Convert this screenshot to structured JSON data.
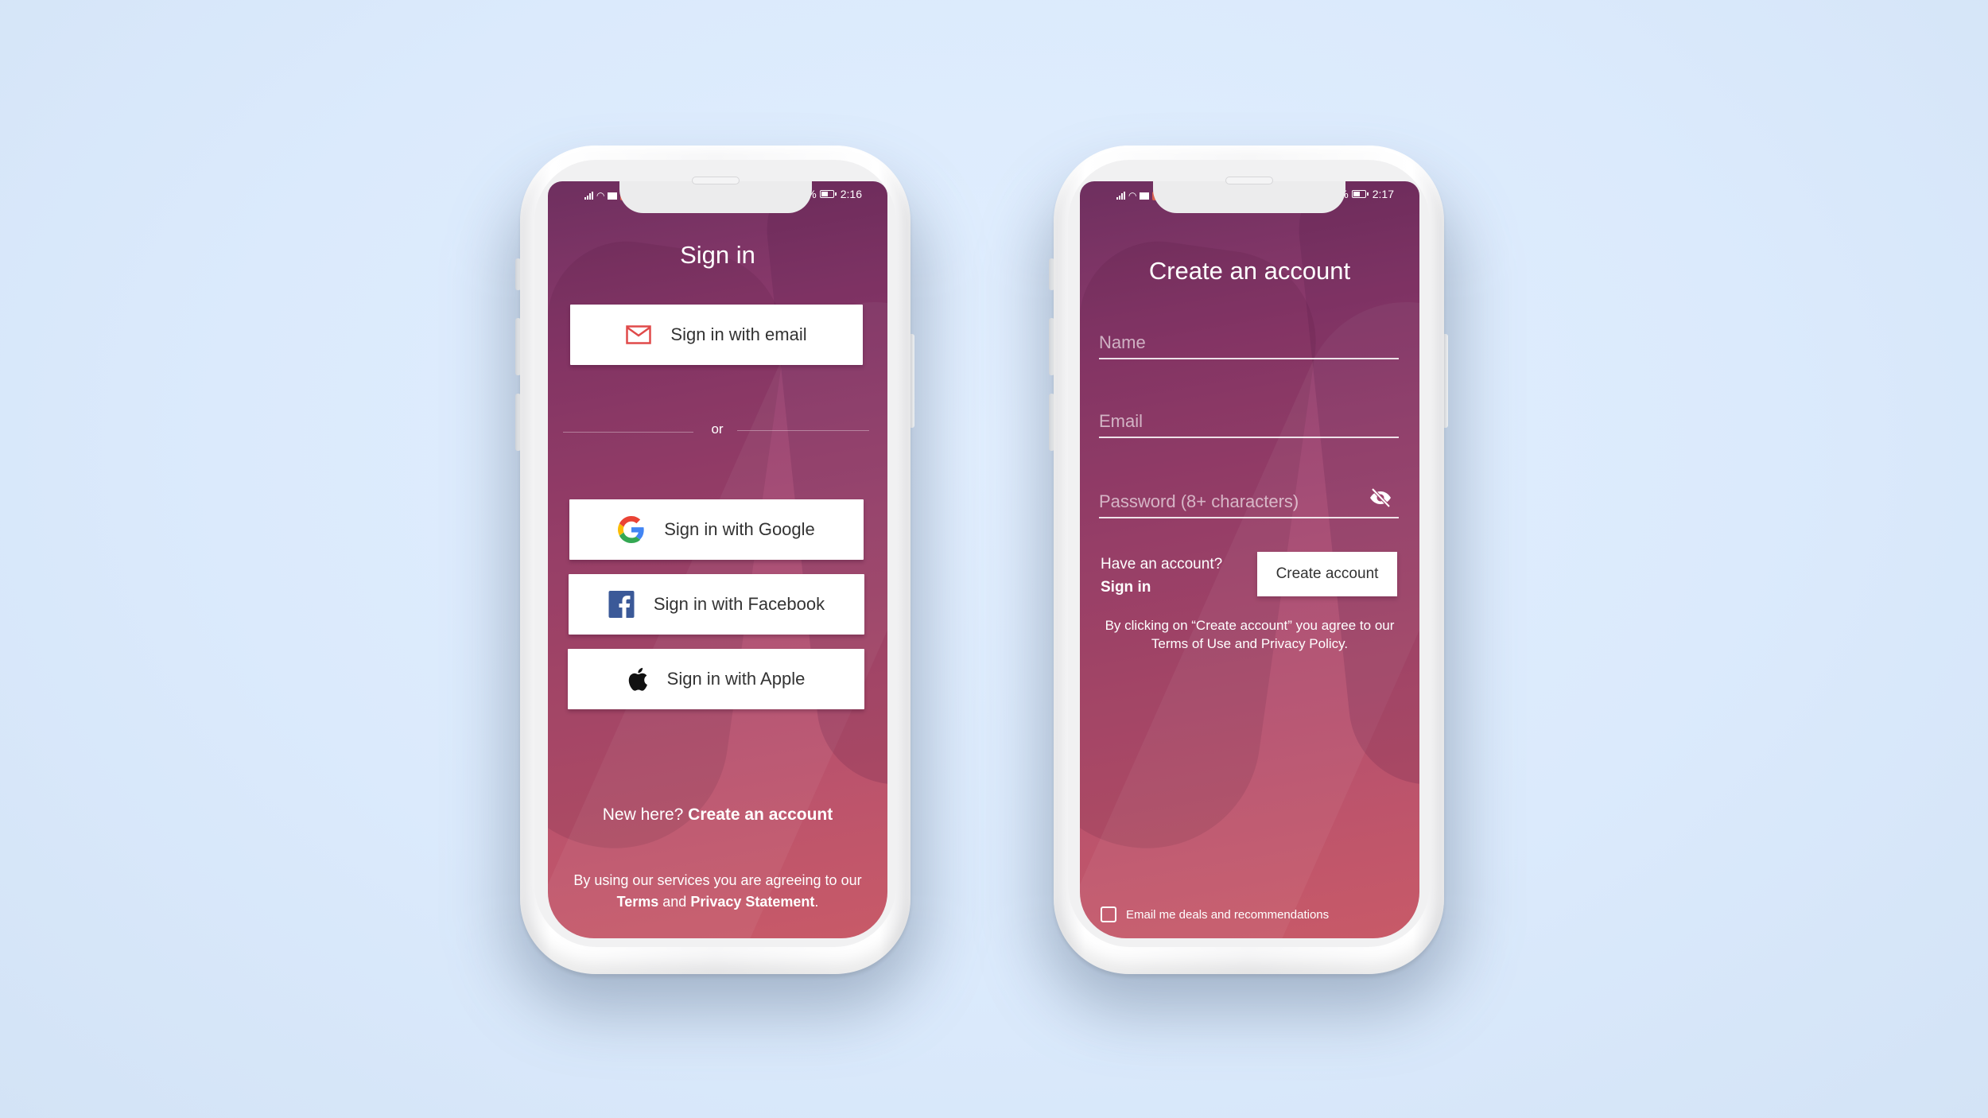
{
  "colors": {
    "background": "#dbeafc",
    "gradient_top": "#6e2f5f",
    "gradient_bottom": "#c85a68",
    "email_icon": "#e04a4a",
    "facebook": "#3b5998",
    "google_blue": "#4285F4",
    "google_red": "#EA4335",
    "google_yellow": "#FBBC05",
    "google_green": "#34A853"
  },
  "phones": [
    {
      "screen": "sign-in",
      "status_bar": {
        "battery_pct_visible": "%",
        "time": "2:16",
        "icons_left": [
          "signal-icon",
          "wifi-icon",
          "mail-icon",
          "notification-icon"
        ]
      },
      "title": "Sign in",
      "email_button": {
        "label": "Sign in with email",
        "icon": "envelope-icon"
      },
      "divider": {
        "label": "or"
      },
      "social_buttons": [
        {
          "label": "Sign in with Google",
          "icon": "google-icon"
        },
        {
          "label": "Sign in with Facebook",
          "icon": "facebook-icon"
        },
        {
          "label": "Sign in with Apple",
          "icon": "apple-icon"
        }
      ],
      "footer": {
        "prompt": "New here?",
        "link": "Create an account"
      },
      "legal": {
        "prefix": "By using our services you are agreeing to our",
        "terms": "Terms",
        "and": "and",
        "privacy": "Privacy Statement",
        "suffix": "."
      }
    },
    {
      "screen": "create-account",
      "status_bar": {
        "battery_pct_visible": "%",
        "time": "2:17",
        "icons_left": [
          "signal-icon",
          "wifi-icon",
          "mail-icon",
          "notification-icon"
        ]
      },
      "title": "Create an account",
      "fields": [
        {
          "name": "name",
          "placeholder": "Name",
          "value": ""
        },
        {
          "name": "email",
          "placeholder": "Email",
          "value": ""
        },
        {
          "name": "password",
          "placeholder": "Password (8+ characters)",
          "value": "",
          "toggle_icon": "eye-off-icon"
        }
      ],
      "have_account": {
        "prompt": "Have an account?",
        "link": "Sign in"
      },
      "create_button": {
        "label": "Create account"
      },
      "agreement": "By clicking on “Create account” you agree to our Terms of Use and Privacy Policy.",
      "newsletter_checkbox": {
        "label": "Email me deals and recommendations",
        "checked": false
      }
    }
  ]
}
